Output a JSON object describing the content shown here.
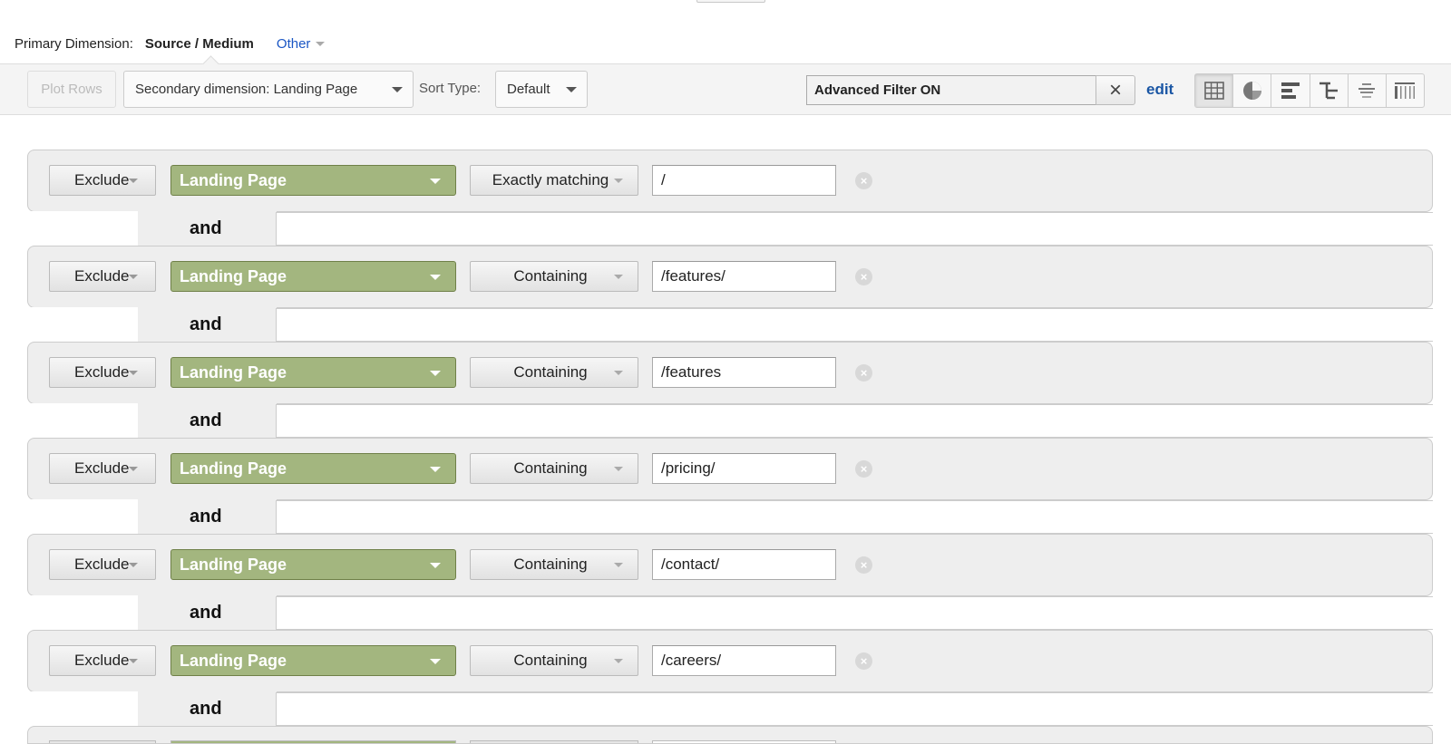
{
  "primary_dimension": {
    "label": "Primary Dimension:",
    "active": "Source / Medium",
    "other": "Other"
  },
  "toolbar": {
    "plot_rows": "Plot Rows",
    "secondary_dimension": "Secondary dimension: Landing Page",
    "sort_label": "Sort Type:",
    "sort_value": "Default",
    "filter_text": "Advanced Filter ON",
    "clear_icon": "×",
    "edit_label": "edit",
    "views": [
      {
        "name": "data-table-view",
        "active": true
      },
      {
        "name": "percentage-view",
        "active": false
      },
      {
        "name": "performance-view",
        "active": false
      },
      {
        "name": "comparison-view",
        "active": false
      },
      {
        "name": "term-cloud-view",
        "active": false
      },
      {
        "name": "pivot-view",
        "active": false
      }
    ]
  },
  "filters": {
    "connector": "and",
    "conditions": [
      {
        "mode": "Exclude",
        "dimension": "Landing Page",
        "match": "Exactly matching",
        "value": "/"
      },
      {
        "mode": "Exclude",
        "dimension": "Landing Page",
        "match": "Containing",
        "value": "/features/"
      },
      {
        "mode": "Exclude",
        "dimension": "Landing Page",
        "match": "Containing",
        "value": "/features"
      },
      {
        "mode": "Exclude",
        "dimension": "Landing Page",
        "match": "Containing",
        "value": "/pricing/"
      },
      {
        "mode": "Exclude",
        "dimension": "Landing Page",
        "match": "Containing",
        "value": "/contact/"
      },
      {
        "mode": "Exclude",
        "dimension": "Landing Page",
        "match": "Containing",
        "value": "/careers/"
      }
    ]
  },
  "colors": {
    "dimension_green": "#a3b67f",
    "link_blue": "#1a56c4"
  }
}
